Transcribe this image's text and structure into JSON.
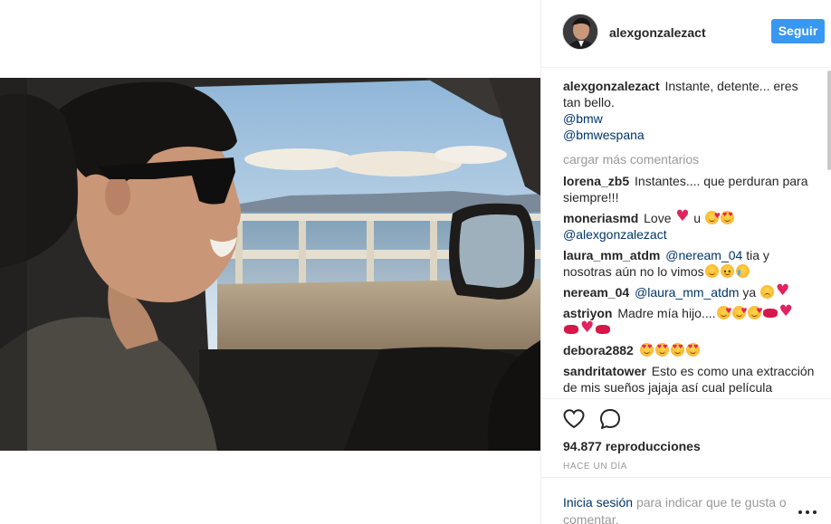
{
  "header": {
    "username": "alexgonzalezact",
    "follow_label": "Seguir"
  },
  "caption": {
    "username": "alexgonzalezact",
    "text": "Instante, detente... eres tan bello.",
    "mentions": [
      "@bmw",
      "@bmwespana"
    ]
  },
  "load_more_label": "cargar más comentarios",
  "comments": [
    {
      "username": "lorena_zb5",
      "text": "Instantes.... que perduran para siempre!!!"
    },
    {
      "username": "moneriasmd",
      "text_before": "Love",
      "text_middle": "u",
      "mention": "@alexgonzalezact"
    },
    {
      "username": "laura_mm_atdm",
      "mention": "@neream_04",
      "text": "tia y nosotras aún no lo vimos"
    },
    {
      "username": "neream_04",
      "mention": "@laura_mm_atdm",
      "text": "ya"
    },
    {
      "username": "astriyon",
      "text": "Madre mía hijo...."
    },
    {
      "username": "debora2882",
      "text": ""
    },
    {
      "username": "sandritatower",
      "text": "Esto es como una extracción de mis sueños jajaja así cual película"
    }
  ],
  "stats": {
    "views_count": "94.877",
    "views_label": "reproducciones",
    "time_ago": "HACE UN DÍA"
  },
  "login": {
    "link_label": "Inicia sesión",
    "text": "para indicar que te gusta o comentar."
  },
  "icons": {
    "like": "heart-outline-icon",
    "comment": "speech-bubble-icon",
    "more": "more-options-icon"
  },
  "colors": {
    "accent": "#3897f0",
    "link": "#003569",
    "muted": "#999999",
    "text": "#262626"
  }
}
